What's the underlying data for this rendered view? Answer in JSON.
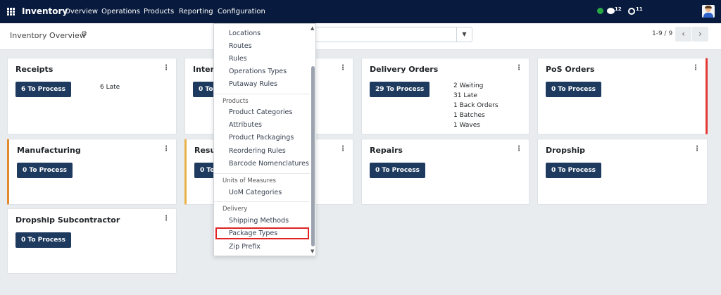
{
  "navbar": {
    "brand": "Inventory",
    "menu": [
      "Overview",
      "Operations",
      "Products",
      "Reporting",
      "Configuration"
    ],
    "chat_count": "12",
    "activity_count": "11"
  },
  "control": {
    "title": "Inventory Overview",
    "pager": "1-9 / 9"
  },
  "cards": [
    {
      "title": "Receipts",
      "button": "6 To Process",
      "stats": [
        "6 Late"
      ]
    },
    {
      "title": "Intern",
      "button": "0 To",
      "stats": []
    },
    {
      "title": "Delivery Orders",
      "button": "29 To Process",
      "stats": [
        "2 Waiting",
        "31 Late",
        "1 Back Orders",
        "1 Batches",
        "1 Waves"
      ]
    },
    {
      "title": "PoS Orders",
      "button": "0 To Process",
      "stats": []
    },
    {
      "title": "Manufacturing",
      "button": "0 To Process",
      "stats": []
    },
    {
      "title": "Resup",
      "button": "0 To",
      "stats": []
    },
    {
      "title": "Repairs",
      "button": "0 To Process",
      "stats": []
    },
    {
      "title": "Dropship",
      "button": "0 To Process",
      "stats": []
    },
    {
      "title": "Dropship Subcontractor",
      "button": "0 To Process",
      "stats": []
    }
  ],
  "dropdown": {
    "items_top": [
      "Locations",
      "Routes",
      "Rules",
      "Operations Types",
      "Putaway Rules"
    ],
    "products_header": "Products",
    "products_items": [
      "Product Categories",
      "Attributes",
      "Product Packagings",
      "Reordering Rules",
      "Barcode Nomenclatures"
    ],
    "uom_header": "Units of Measures",
    "uom_items": [
      "UoM Categories"
    ],
    "delivery_header": "Delivery",
    "delivery_items": [
      "Shipping Methods",
      "Package Types",
      "Zip Prefix"
    ]
  },
  "colors": {
    "navbar": "#081a3d",
    "button": "#1e3a5f",
    "highlight": "#e02424",
    "status_online": "#28a745"
  }
}
